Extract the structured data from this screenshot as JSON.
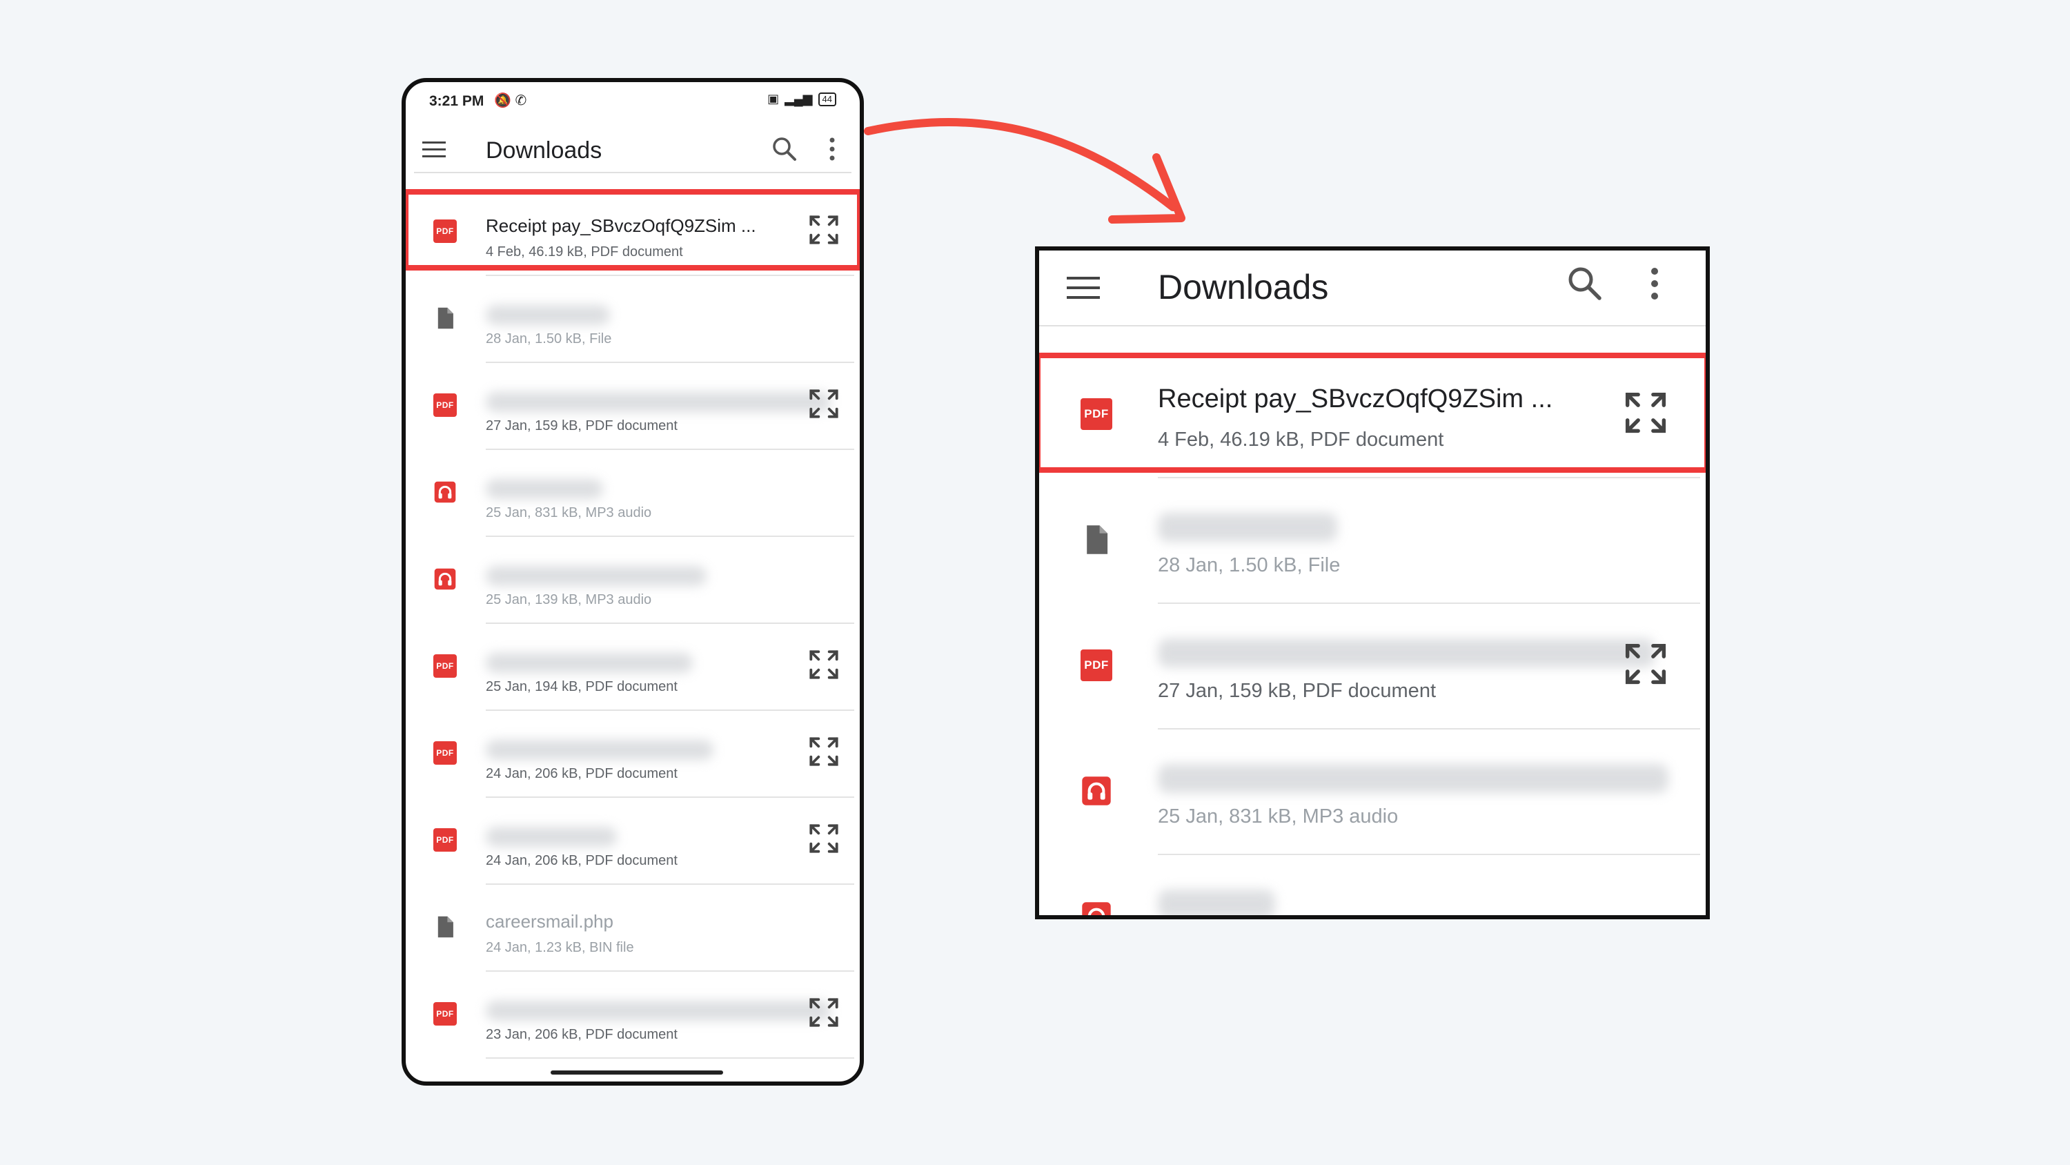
{
  "phone": {
    "status": {
      "time": "3:21 PM",
      "battery": "44"
    },
    "app_title": "Downloads",
    "files": [
      {
        "name": "Receipt pay_SBvczOqfQ9ZSim ...",
        "meta": "4 Feb, 46.19 kB, PDF document",
        "type": "pdf",
        "expand": true,
        "highlighted": true
      },
      {
        "name": "",
        "meta": "28 Jan, 1.50 kB, File",
        "type": "file",
        "expand": false,
        "faded": true
      },
      {
        "name": "",
        "meta": "27 Jan, 159 kB, PDF document",
        "type": "pdf",
        "expand": true
      },
      {
        "name": "",
        "meta": "25 Jan, 831 kB, MP3 audio",
        "type": "audio",
        "expand": false,
        "faded": true
      },
      {
        "name": "",
        "meta": "25 Jan, 139 kB, MP3 audio",
        "type": "audio",
        "expand": false,
        "faded": true
      },
      {
        "name": "",
        "meta": "25 Jan, 194 kB, PDF document",
        "type": "pdf",
        "expand": true
      },
      {
        "name": "",
        "meta": "24 Jan, 206 kB, PDF document",
        "type": "pdf",
        "expand": true
      },
      {
        "name": "",
        "meta": "24 Jan, 206 kB, PDF document",
        "type": "pdf",
        "expand": true
      },
      {
        "name": "careersmail.php",
        "meta": "24 Jan, 1.23 kB, BIN file",
        "type": "file",
        "expand": false,
        "faded": true
      },
      {
        "name": "",
        "meta": "23 Jan, 206 kB, PDF document",
        "type": "pdf",
        "expand": true
      }
    ]
  },
  "zoom": {
    "app_title": "Downloads",
    "files": [
      {
        "name": "Receipt pay_SBvczOqfQ9ZSim ...",
        "meta": "4 Feb, 46.19 kB, PDF document",
        "type": "pdf",
        "expand": true,
        "highlighted": true
      },
      {
        "name": "",
        "meta": "28 Jan, 1.50 kB, File",
        "type": "file",
        "expand": false,
        "faded": true
      },
      {
        "name": "",
        "meta": "27 Jan, 159 kB, PDF document",
        "type": "pdf",
        "expand": true
      },
      {
        "name": "",
        "meta": "25 Jan, 831 kB, MP3 audio",
        "type": "audio",
        "expand": false,
        "faded": true
      },
      {
        "name": "",
        "meta": "",
        "type": "audio",
        "expand": false,
        "faded": true
      }
    ]
  },
  "icons": {
    "pdf_label": "PDF",
    "accent": "#ef3a3a",
    "pdf_color": "#e53935",
    "file_color": "#616161"
  }
}
